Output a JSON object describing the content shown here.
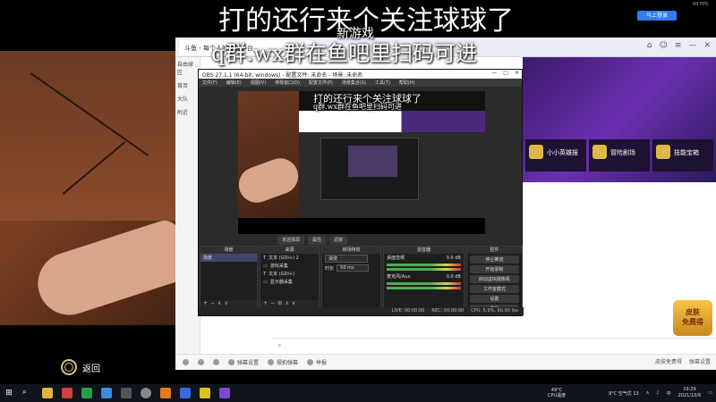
{
  "overlay": {
    "line1": "打的还行来个关注球球了",
    "line2_small": "新游戏",
    "line3": "q群.wx群在鱼吧里扫码可进"
  },
  "top": {
    "login_button": "马上登录",
    "corner_info": "60 FPS"
  },
  "camera": {
    "back_label": "返回"
  },
  "browser": {
    "tab_title": "斗鱼 - 每个人的直播平台",
    "sidebar_items": [
      "自由球区",
      "首页",
      "大队",
      "附近"
    ],
    "banner_cards": [
      "小小英雄报",
      "冒险剧场",
      "技能宝箱"
    ],
    "chat_placeholder": "",
    "bottom_tools": [
      "弹幕设置",
      "摆拍弹幕",
      "举报"
    ],
    "bottom_right": [
      "皮肤免费得",
      "弹幕设置"
    ],
    "skin_badge_line1": "皮肤",
    "skin_badge_line2": "免费得"
  },
  "obs": {
    "title": "OBS 27.1.1 (64-bit, windows) - 配置文件: 未命名 - 场景: 未命名",
    "menu": [
      "文件(F)",
      "编辑(E)",
      "视图(V)",
      "停靠窗口(D)",
      "配置文件(P)",
      "场景集合(S)",
      "工具(T)",
      "帮助(H)"
    ],
    "preview_text_1": "打的还行来个关注球球了",
    "preview_text_2": "q群.wx群在鱼吧里扫码可进",
    "dock_tabs": [
      "未选择源",
      "属性",
      "滤镜"
    ],
    "docks": {
      "scenes": {
        "title": "场景",
        "items": [
          "场景"
        ]
      },
      "sources": {
        "title": "来源",
        "items": [
          "文本 (GDI+) 2",
          "游戏采集",
          "文本 (GDI+)",
          "显示器采集"
        ]
      },
      "transitions": {
        "title": "转场特效",
        "fade": "渐变",
        "duration_label": "时长",
        "duration_value": "50 ms"
      },
      "mixer": {
        "title": "混音器",
        "ch1": "桌面音频",
        "ch2": "麦克风/Aux",
        "ch1_db": "0.0 dB",
        "ch2_db": "0.0 dB"
      },
      "controls": {
        "title": "控件",
        "buttons": [
          "停止推流",
          "开始录制",
          "启动虚拟摄像机",
          "工作室模式",
          "设置",
          "退出"
        ]
      }
    },
    "status": [
      "LIVE: 00:00:00",
      "REC: 00:00:00",
      "CPU: 5.9%, 60.00 fps"
    ]
  },
  "taskbar": {
    "cpu_temp_value": "49°C",
    "cpu_temp_label": "CPU温度",
    "weather": "9°C 空气优 13",
    "time": "19:29",
    "date": "2021/10/6"
  }
}
